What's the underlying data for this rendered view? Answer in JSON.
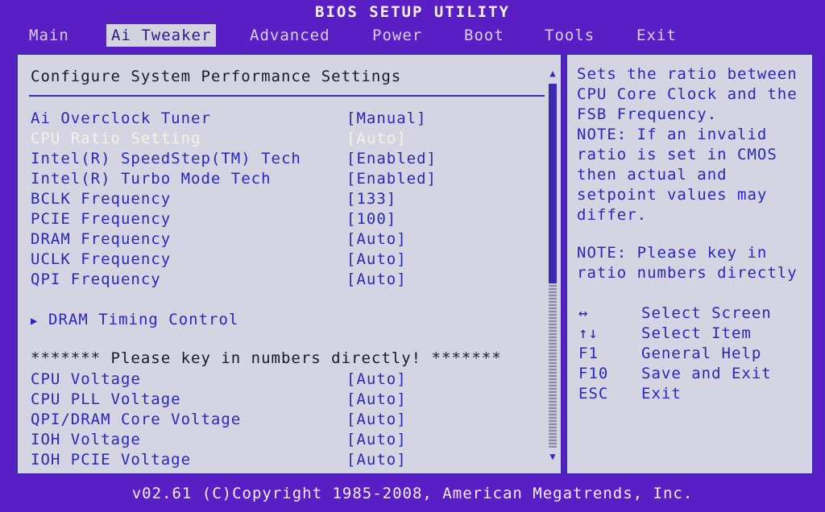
{
  "title": "BIOS SETUP UTILITY",
  "menu": [
    {
      "label": "Main"
    },
    {
      "label": "Ai Tweaker"
    },
    {
      "label": "Advanced"
    },
    {
      "label": "Power"
    },
    {
      "label": "Boot"
    },
    {
      "label": "Tools"
    },
    {
      "label": "Exit"
    }
  ],
  "main": {
    "section_title": "Configure System Performance Settings",
    "settings": [
      {
        "label": "Ai Overclock Tuner",
        "value": "[Manual]"
      },
      {
        "label": "CPU Ratio Setting",
        "value": "[Auto]"
      },
      {
        "label": "Intel(R) SpeedStep(TM) Tech",
        "value": "[Enabled]"
      },
      {
        "label": "Intel(R) Turbo Mode Tech",
        "value": "[Enabled]"
      },
      {
        "label": "BCLK Frequency",
        "value": "[133]"
      },
      {
        "label": "PCIE Frequency",
        "value": "[100]"
      },
      {
        "label": "DRAM Frequency",
        "value": "[Auto]"
      },
      {
        "label": "UCLK Frequency",
        "value": "[Auto]"
      },
      {
        "label": "QPI Frequency",
        "value": "[Auto]"
      }
    ],
    "submenu_label": "DRAM Timing Control",
    "note": "******* Please key in numbers directly! *******",
    "voltages": [
      {
        "label": "CPU Voltage",
        "value": "[Auto]"
      },
      {
        "label": "CPU PLL Voltage",
        "value": "[Auto]"
      },
      {
        "label": "QPI/DRAM Core Voltage",
        "value": "[Auto]"
      },
      {
        "label": "IOH Voltage",
        "value": "[Auto]"
      },
      {
        "label": "IOH PCIE Voltage",
        "value": "[Auto]"
      }
    ]
  },
  "help": {
    "description": "Sets the ratio between\nCPU Core Clock and the\nFSB Frequency.\nNOTE: If an invalid\nratio is set in CMOS\nthen actual and\nsetpoint values may\ndiffer.",
    "note2": "NOTE: Please key in\nratio numbers directly",
    "keys": [
      {
        "key": "↔",
        "desc": "Select Screen"
      },
      {
        "key": "↑↓",
        "desc": "Select Item"
      },
      {
        "key": "F1",
        "desc": "General Help"
      },
      {
        "key": "F10",
        "desc": "Save and Exit"
      },
      {
        "key": "ESC",
        "desc": "Exit"
      }
    ]
  },
  "footer": "v02.61 (C)Copyright 1985-2008, American Megatrends, Inc.",
  "colors": {
    "background": "#5a1fc4",
    "panel": "#d4d4e2",
    "text": "#2a28b8",
    "highlight": "#f6f2e4"
  }
}
